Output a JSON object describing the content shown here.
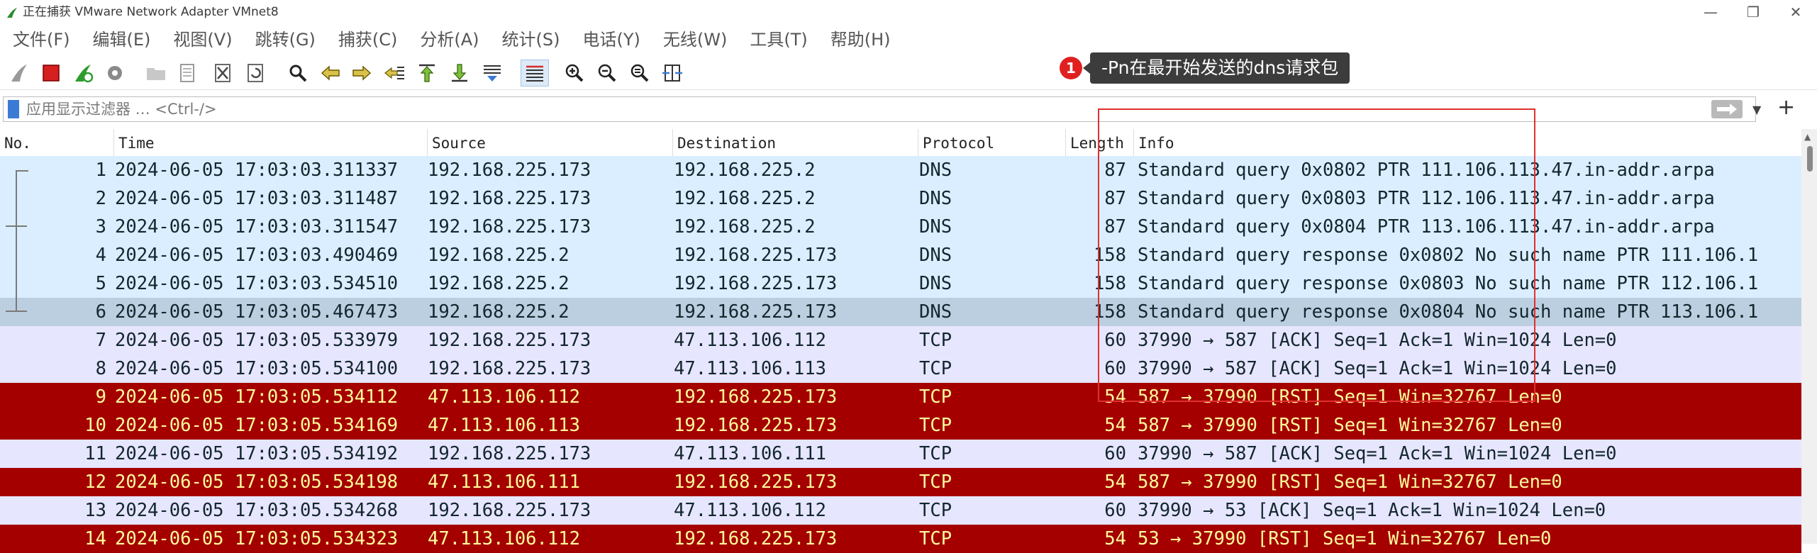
{
  "window": {
    "title": "正在捕获 VMware Network Adapter VMnet8"
  },
  "menu": [
    "文件(F)",
    "编辑(E)",
    "视图(V)",
    "跳转(G)",
    "捕获(C)",
    "分析(A)",
    "统计(S)",
    "电话(Y)",
    "无线(W)",
    "工具(T)",
    "帮助(H)"
  ],
  "annotation": {
    "badge": "1",
    "text": "-Pn在最开始发送的dns请求包"
  },
  "filter": {
    "placeholder": "应用显示过滤器 … <Ctrl-/>"
  },
  "columns": [
    "No.",
    "Time",
    "Source",
    "Destination",
    "Protocol",
    "Length",
    "Info"
  ],
  "colors": {
    "dns_row": "#daeeff",
    "dns_selected": "#bccfe0",
    "tcp_row": "#e7e6ff",
    "rst_row": "#a40000",
    "rst_text": "#fffc9c",
    "normal_text": "#12272e",
    "annotation_red": "#e03030"
  },
  "packets": [
    {
      "no": "1",
      "time": "2024-06-05 17:03:03.311337",
      "src": "192.168.225.173",
      "dst": "192.168.225.2",
      "proto": "DNS",
      "len": "87",
      "info": "Standard query 0x0802 PTR 111.106.113.47.in-addr.arpa",
      "style": "dns"
    },
    {
      "no": "2",
      "time": "2024-06-05 17:03:03.311487",
      "src": "192.168.225.173",
      "dst": "192.168.225.2",
      "proto": "DNS",
      "len": "87",
      "info": "Standard query 0x0803 PTR 112.106.113.47.in-addr.arpa",
      "style": "dns"
    },
    {
      "no": "3",
      "time": "2024-06-05 17:03:03.311547",
      "src": "192.168.225.173",
      "dst": "192.168.225.2",
      "proto": "DNS",
      "len": "87",
      "info": "Standard query 0x0804 PTR 113.106.113.47.in-addr.arpa",
      "style": "dns"
    },
    {
      "no": "4",
      "time": "2024-06-05 17:03:03.490469",
      "src": "192.168.225.2",
      "dst": "192.168.225.173",
      "proto": "DNS",
      "len": "158",
      "info": "Standard query response 0x0802 No such name PTR 111.106.1",
      "style": "dns"
    },
    {
      "no": "5",
      "time": "2024-06-05 17:03:03.534510",
      "src": "192.168.225.2",
      "dst": "192.168.225.173",
      "proto": "DNS",
      "len": "158",
      "info": "Standard query response 0x0803 No such name PTR 112.106.1",
      "style": "dns"
    },
    {
      "no": "6",
      "time": "2024-06-05 17:03:05.467473",
      "src": "192.168.225.2",
      "dst": "192.168.225.173",
      "proto": "DNS",
      "len": "158",
      "info": "Standard query response 0x0804 No such name PTR 113.106.1",
      "style": "selected"
    },
    {
      "no": "7",
      "time": "2024-06-05 17:03:05.533979",
      "src": "192.168.225.173",
      "dst": "47.113.106.112",
      "proto": "TCP",
      "len": "60",
      "info": "37990 → 587 [ACK] Seq=1 Ack=1 Win=1024 Len=0",
      "style": "tcp"
    },
    {
      "no": "8",
      "time": "2024-06-05 17:03:05.534100",
      "src": "192.168.225.173",
      "dst": "47.113.106.113",
      "proto": "TCP",
      "len": "60",
      "info": "37990 → 587 [ACK] Seq=1 Ack=1 Win=1024 Len=0",
      "style": "tcp"
    },
    {
      "no": "9",
      "time": "2024-06-05 17:03:05.534112",
      "src": "47.113.106.112",
      "dst": "192.168.225.173",
      "proto": "TCP",
      "len": "54",
      "info": "587 → 37990 [RST] Seq=1 Win=32767 Len=0",
      "style": "rst"
    },
    {
      "no": "10",
      "time": "2024-06-05 17:03:05.534169",
      "src": "47.113.106.113",
      "dst": "192.168.225.173",
      "proto": "TCP",
      "len": "54",
      "info": "587 → 37990 [RST] Seq=1 Win=32767 Len=0",
      "style": "rst"
    },
    {
      "no": "11",
      "time": "2024-06-05 17:03:05.534192",
      "src": "192.168.225.173",
      "dst": "47.113.106.111",
      "proto": "TCP",
      "len": "60",
      "info": "37990 → 587 [ACK] Seq=1 Ack=1 Win=1024 Len=0",
      "style": "tcp"
    },
    {
      "no": "12",
      "time": "2024-06-05 17:03:05.534198",
      "src": "47.113.106.111",
      "dst": "192.168.225.173",
      "proto": "TCP",
      "len": "54",
      "info": "587 → 37990 [RST] Seq=1 Win=32767 Len=0",
      "style": "rst"
    },
    {
      "no": "13",
      "time": "2024-06-05 17:03:05.534268",
      "src": "192.168.225.173",
      "dst": "47.113.106.112",
      "proto": "TCP",
      "len": "60",
      "info": "37990 → 53 [ACK] Seq=1 Ack=1 Win=1024 Len=0",
      "style": "tcp"
    },
    {
      "no": "14",
      "time": "2024-06-05 17:03:05.534323",
      "src": "47.113.106.112",
      "dst": "192.168.225.173",
      "proto": "TCP",
      "len": "54",
      "info": "53 → 37990 [RST] Seq=1 Win=32767 Len=0",
      "style": "rst"
    }
  ]
}
